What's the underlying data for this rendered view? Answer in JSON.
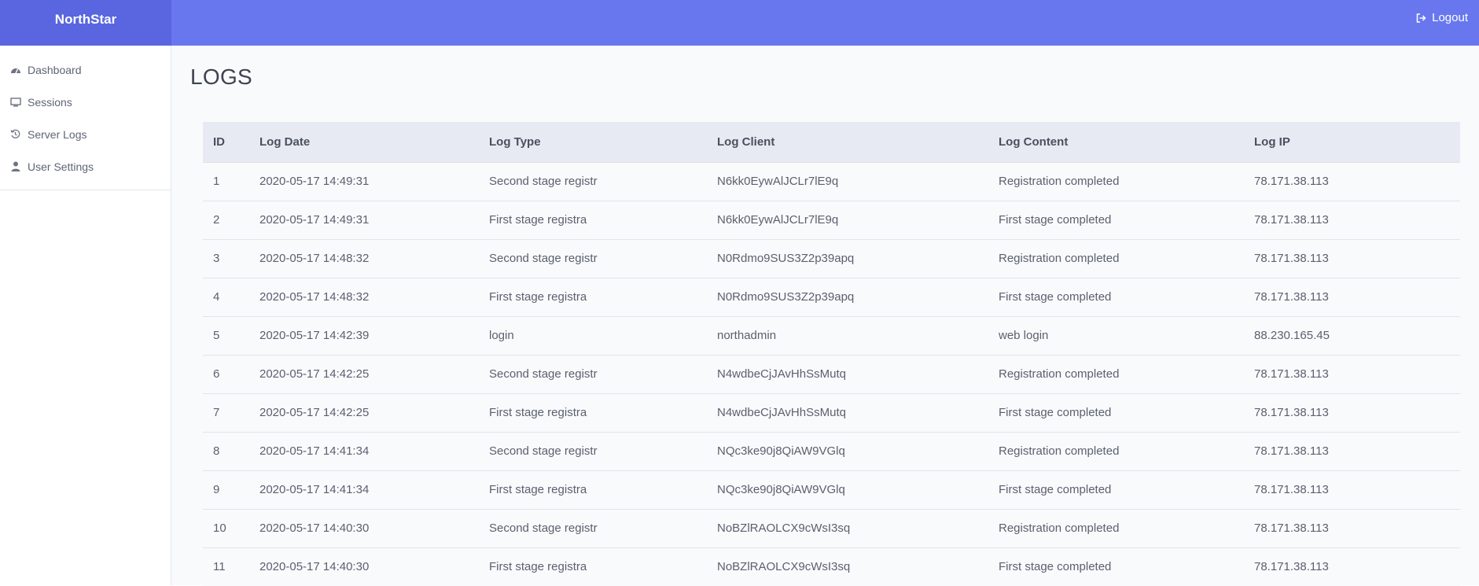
{
  "app": {
    "brand": "NorthStar",
    "logout_label": "Logout"
  },
  "sidebar": {
    "items": [
      {
        "label": "Dashboard",
        "icon": "dashboard-icon"
      },
      {
        "label": "Sessions",
        "icon": "monitor-icon"
      },
      {
        "label": "Server Logs",
        "icon": "history-icon"
      },
      {
        "label": "User Settings",
        "icon": "user-icon"
      }
    ]
  },
  "page": {
    "title": "LOGS"
  },
  "table": {
    "headers": [
      "ID",
      "Log Date",
      "Log Type",
      "Log Client",
      "Log Content",
      "Log IP"
    ],
    "rows": [
      [
        "1",
        "2020-05-17 14:49:31",
        "Second stage registr",
        "N6kk0EywAlJCLr7lE9q",
        "Registration completed",
        "78.171.38.113"
      ],
      [
        "2",
        "2020-05-17 14:49:31",
        "First stage registra",
        "N6kk0EywAlJCLr7lE9q",
        "First stage completed",
        "78.171.38.113"
      ],
      [
        "3",
        "2020-05-17 14:48:32",
        "Second stage registr",
        "N0Rdmo9SUS3Z2p39apq",
        "Registration completed",
        "78.171.38.113"
      ],
      [
        "4",
        "2020-05-17 14:48:32",
        "First stage registra",
        "N0Rdmo9SUS3Z2p39apq",
        "First stage completed",
        "78.171.38.113"
      ],
      [
        "5",
        "2020-05-17 14:42:39",
        "login",
        "northadmin",
        "web login",
        "88.230.165.45"
      ],
      [
        "6",
        "2020-05-17 14:42:25",
        "Second stage registr",
        "N4wdbeCjJAvHhSsMutq",
        "Registration completed",
        "78.171.38.113"
      ],
      [
        "7",
        "2020-05-17 14:42:25",
        "First stage registra",
        "N4wdbeCjJAvHhSsMutq",
        "First stage completed",
        "78.171.38.113"
      ],
      [
        "8",
        "2020-05-17 14:41:34",
        "Second stage registr",
        "NQc3ke90j8QiAW9VGlq",
        "Registration completed",
        "78.171.38.113"
      ],
      [
        "9",
        "2020-05-17 14:41:34",
        "First stage registra",
        "NQc3ke90j8QiAW9VGlq",
        "First stage completed",
        "78.171.38.113"
      ],
      [
        "10",
        "2020-05-17 14:40:30",
        "Second stage registr",
        "NoBZlRAOLCX9cWsI3sq",
        "Registration completed",
        "78.171.38.113"
      ],
      [
        "11",
        "2020-05-17 14:40:30",
        "First stage registra",
        "NoBZlRAOLCX9cWsI3sq",
        "First stage completed",
        "78.171.38.113"
      ]
    ]
  },
  "colors": {
    "topbar": "#6877ee",
    "brand_bg": "#5966e0",
    "table_header_bg": "#e8eaf3",
    "content_bg": "#f9fafb"
  }
}
